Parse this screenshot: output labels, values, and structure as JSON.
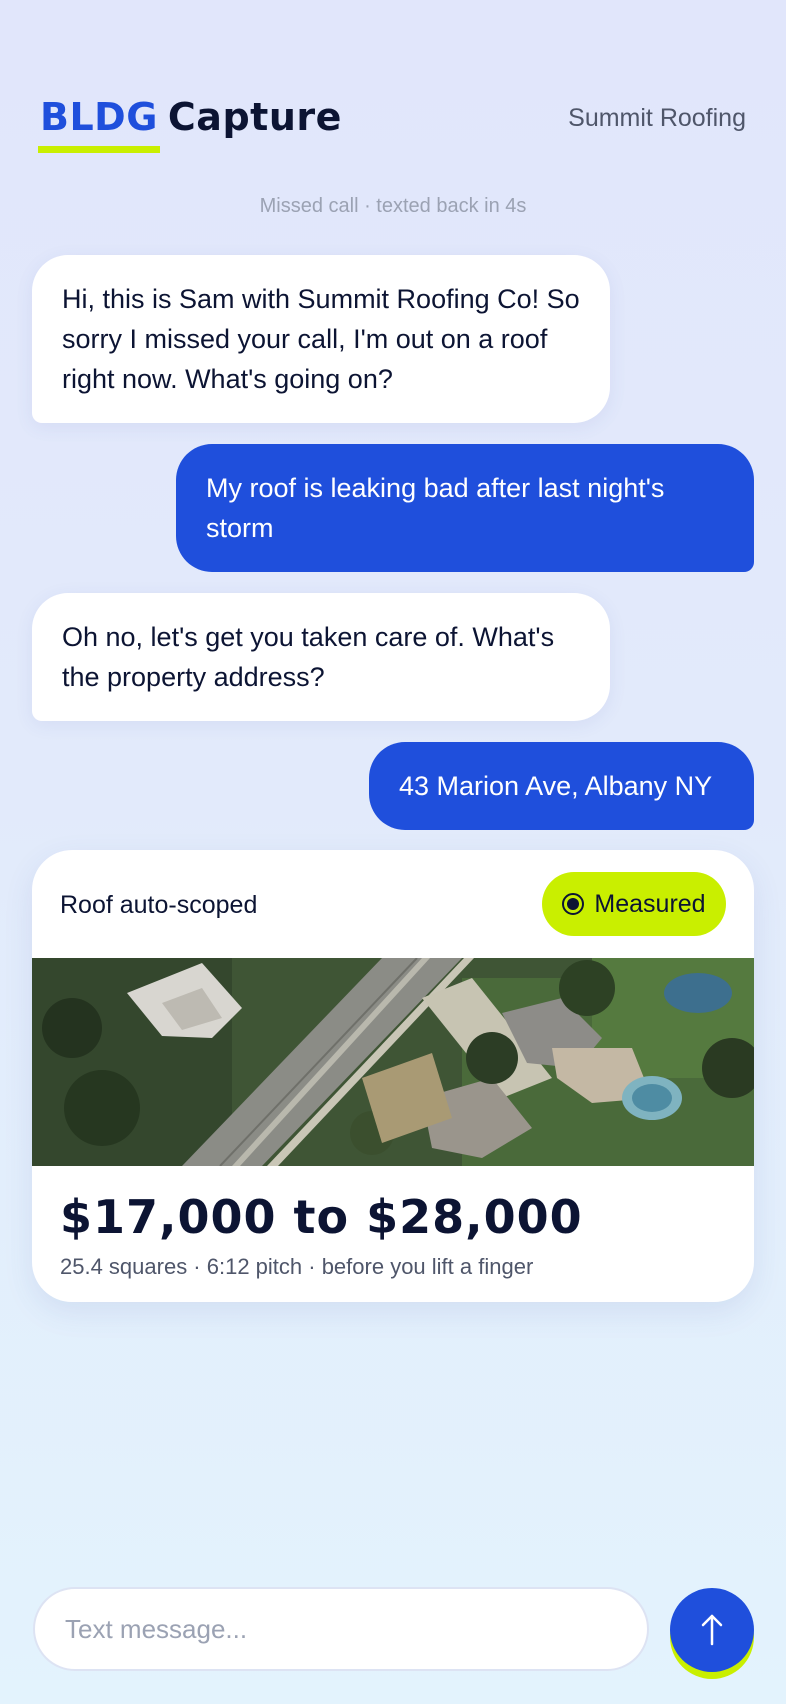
{
  "header": {
    "brand_primary": "BLDG",
    "brand_secondary": "Capture",
    "company": "Summit Roofing"
  },
  "conversation": {
    "system_note": "Missed call · texted back in 4s",
    "messages": [
      {
        "direction": "incoming",
        "text": "Hi, this is Sam with Summit Roofing Co! So sorry I missed your call, I'm out on a roof right now. What's going on?"
      },
      {
        "direction": "outgoing",
        "text": "My roof is leaking bad after last night's storm"
      },
      {
        "direction": "incoming",
        "text": "Oh no, let's get you taken care of. What's the property address?"
      },
      {
        "direction": "outgoing",
        "text": "43 Marion Ave, Albany NY"
      }
    ]
  },
  "estimate_card": {
    "title": "Roof auto-scoped",
    "status_badge": "Measured",
    "status_icon": "radio-dot-icon",
    "image": "aerial-satellite-view",
    "price_range": "$17,000 to $28,000",
    "details": "25.4 squares · 6:12 pitch · before you lift a finger"
  },
  "composer": {
    "placeholder": "Text message...",
    "send_icon": "arrow-up-icon"
  },
  "colors": {
    "accent_blue": "#1f4fdc",
    "accent_lime": "#c9ef00",
    "ink": "#0c1433"
  }
}
